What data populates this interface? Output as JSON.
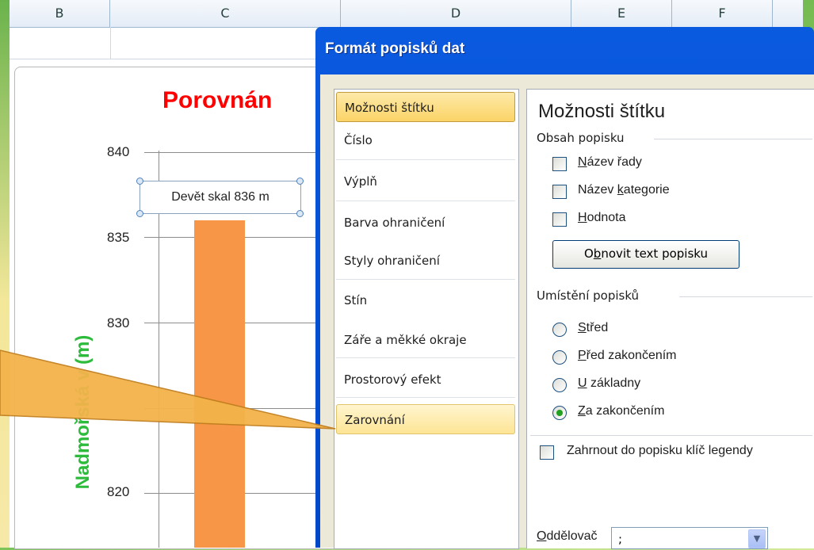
{
  "sheet": {
    "columns": [
      "B",
      "C",
      "D",
      "E",
      "F"
    ]
  },
  "chart": {
    "title_visible": "Porovnán",
    "y_axis_title_visible": "Nadmořská v (m)",
    "data_label": "Devět skal 836 m",
    "bar_color": "#f79646"
  },
  "chart_data": {
    "type": "bar",
    "categories": [
      "Devět skal"
    ],
    "values": [
      836
    ],
    "ylabel": "Nadmořská v (m)",
    "ylim": [
      815,
      840
    ],
    "yticks": [
      "840",
      "835",
      "830",
      "820"
    ]
  },
  "dialog": {
    "title": "Formát popisků dat",
    "categories": [
      "Možnosti štítku",
      "Číslo",
      "Výplň",
      "Barva ohraničení",
      "Styly ohraničení",
      "Stín",
      "Záře a měkké okraje",
      "Prostorový efekt",
      "Zarovnání"
    ],
    "selected_category": "Možnosti štítku",
    "panel": {
      "heading": "Možnosti štítku",
      "content_group": "Obsah popisku",
      "series_name_pre": "",
      "series_name_key": "N",
      "series_name_post": "ázev řady",
      "category_name_pre": "Název ",
      "category_name_key": "k",
      "category_name_post": "ategorie",
      "value_pre": "",
      "value_key": "H",
      "value_post": "odnota",
      "reset_pre": "O",
      "reset_key": "b",
      "reset_post": "novit text popisku",
      "position_group": "Umístění popisků",
      "pos_center_key": "S",
      "pos_center_post": "třed",
      "pos_inside_end_key": "P",
      "pos_inside_end_post": "řed zakončením",
      "pos_inside_base_key": "U",
      "pos_inside_base_post": " základny",
      "pos_outside_end_key": "Z",
      "pos_outside_end_post": "a zakončením",
      "selected_position": "Za zakončením",
      "legend_key": "Zahrnout do popisku klíč legendy",
      "separator_label_key": "O",
      "separator_label_post": "ddělovač",
      "separator_value": ";"
    }
  },
  "colors": {
    "title_red": "#ff0000",
    "axis_title_green": "#2dbb3c",
    "dialog_blue": "#0a5ae0",
    "callout": "#f3b34a"
  }
}
